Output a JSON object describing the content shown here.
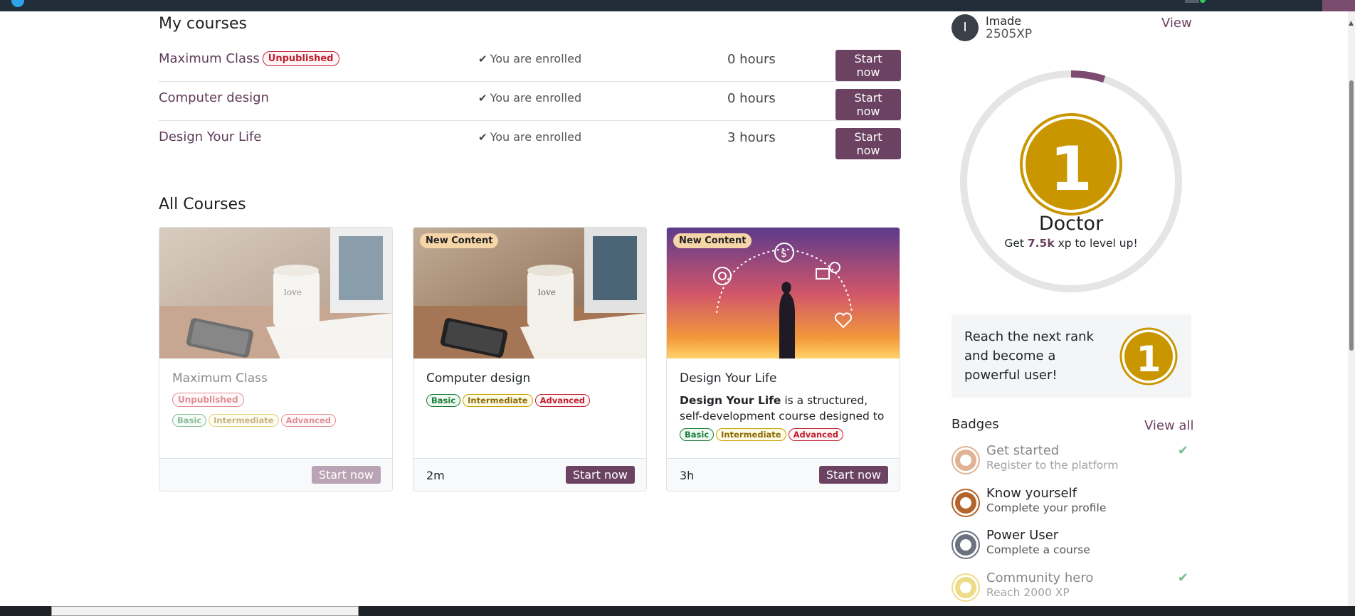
{
  "my_courses": {
    "title": "My courses",
    "rows": [
      {
        "name": "Maximum Class",
        "badge": "Unpublished",
        "status": "You are enrolled",
        "hours": "0 hours",
        "action": "Start now"
      },
      {
        "name": "Computer design",
        "badge": "",
        "status": "You are enrolled",
        "hours": "0 hours",
        "action": "Start now"
      },
      {
        "name": "Design Your Life",
        "badge": "",
        "status": "You are enrolled",
        "hours": "3 hours",
        "action": "Start now"
      }
    ]
  },
  "all_courses": {
    "title": "All Courses",
    "cards": [
      {
        "title": "Maximum Class",
        "tag": "",
        "status_badge": "Unpublished",
        "desc_bold": "",
        "desc_rest": "",
        "levels": [
          "Basic",
          "Intermediate",
          "Advanced"
        ],
        "duration": "",
        "action": "Start now"
      },
      {
        "title": "Computer design",
        "tag": "New Content",
        "status_badge": "",
        "desc_bold": "",
        "desc_rest": "",
        "levels": [
          "Basic",
          "Intermediate",
          "Advanced"
        ],
        "duration": "2m",
        "action": "Start now"
      },
      {
        "title": "Design Your Life",
        "tag": "New Content",
        "status_badge": "",
        "desc_bold": "Design Your Life",
        "desc_rest": " is a structured, self-development course designed to hel...",
        "levels": [
          "Basic",
          "Intermediate",
          "Advanced"
        ],
        "duration": "3h",
        "action": "Start now"
      }
    ]
  },
  "profile": {
    "avatar_initial": "I",
    "name": "Imade",
    "xp": "2505XP",
    "view_label": "View",
    "rank_number": "1",
    "rank_name": "Doctor",
    "levelup_prefix": "Get ",
    "levelup_amount": "7.5k",
    "levelup_suffix": " xp to level up!",
    "progress_fraction": 0.05,
    "reach_text": "Reach the next rank and become a powerful user!",
    "next_rank_number": "1"
  },
  "badges": {
    "title": "Badges",
    "view_all": "View all",
    "items": [
      {
        "title": "Get started",
        "desc": "Register to the platform",
        "earned": true,
        "color": "#c8763e"
      },
      {
        "title": "Know yourself",
        "desc": "Complete your profile",
        "earned": false,
        "color": "#b4632a"
      },
      {
        "title": "Power User",
        "desc": "Complete a course",
        "earned": false,
        "color": "#6c7280"
      },
      {
        "title": "Community hero",
        "desc": "Reach 2000 XP",
        "earned": true,
        "color": "#e3c12a"
      }
    ]
  },
  "colors": {
    "accent": "#6b4262",
    "rank_gold": "#c99600",
    "ring_track": "#e5e5e5"
  }
}
